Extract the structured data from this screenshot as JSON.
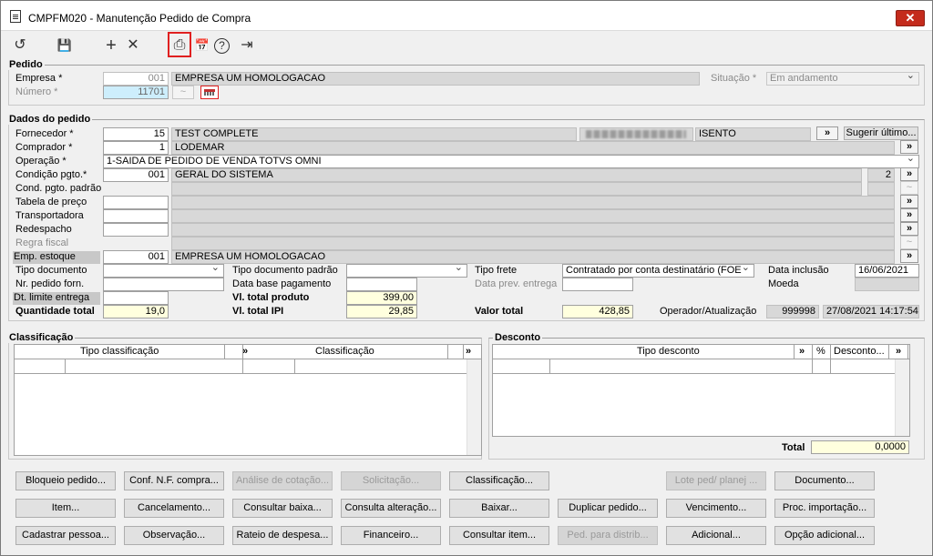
{
  "window": {
    "title": "CMPFM020 - Manutenção Pedido de Compra",
    "close": "✕"
  },
  "toolbar": {
    "undo": "↺",
    "save": "💾",
    "add": "+",
    "delete": "✕",
    "print": "⎙",
    "calendar": "📅",
    "help": "?",
    "exit": "⇥"
  },
  "pedido": {
    "title": "Pedido",
    "empresa_label": "Empresa *",
    "empresa_code": "001",
    "empresa_name": "EMPRESA UM HOMOLOGACAO",
    "situacao_label": "Situação *",
    "situacao_value": "Em andamento",
    "numero_label": "Número *",
    "numero_value": "11701"
  },
  "dados": {
    "title": "Dados do pedido",
    "fornecedor_label": "Fornecedor *",
    "fornecedor_code": "15",
    "fornecedor_name": "TEST COMPLETE",
    "fornecedor_tax": "ISENTO",
    "sugerir": "Sugerir último...",
    "comprador_label": "Comprador *",
    "comprador_code": "1",
    "comprador_name": "LODEMAR",
    "operacao_label": "Operação *",
    "operacao_value": "1-SAIDA DE PEDIDO DE VENDA TOTVS OMNI",
    "condicao_label": "Condição pgto.*",
    "condicao_code": "001",
    "condicao_name": "GERAL DO SISTEMA",
    "condicao_num": "2",
    "cond_padrao_label": "Cond. pgto. padrão",
    "tabela_label": "Tabela de preço",
    "transportadora_label": "Transportadora",
    "redespacho_label": "Redespacho",
    "regra_label": "Regra fiscal",
    "emp_estoque_label": "Emp. estoque",
    "emp_estoque_code": "001",
    "emp_estoque_name": "EMPRESA UM HOMOLOGACAO",
    "tipo_doc_label": "Tipo documento",
    "tipo_doc_padrao_label": "Tipo documento padrão",
    "tipo_frete_label": "Tipo frete",
    "tipo_frete_value": "Contratado por conta destinatário (FOE",
    "data_inclusao_label": "Data inclusão",
    "data_inclusao_value": "16/06/2021",
    "nr_pedido_label": "Nr. pedido forn.",
    "data_base_label": "Data base pagamento",
    "data_prev_label": "Data prev. entrega",
    "moeda_label": "Moeda",
    "dt_limite_label": "Dt. limite entrega",
    "vl_produto_label": "Vl. total produto",
    "vl_produto_value": "399,00",
    "quantidade_label": "Quantidade total",
    "quantidade_value": "19,0",
    "vl_ipi_label": "Vl. total IPI",
    "vl_ipi_value": "29,85",
    "valor_total_label": "Valor total",
    "valor_total_value": "428,85",
    "operador_label": "Operador/Atualização",
    "operador_value": "999998",
    "atualizacao_value": "27/08/2021 14:17:54"
  },
  "classificacao": {
    "title": "Classificação",
    "col_tipo": "Tipo classificação",
    "col_class": "Classificação",
    "more": "»"
  },
  "desconto": {
    "title": "Desconto",
    "col_tipo": "Tipo desconto",
    "col_pct": "%",
    "col_desc": "Desconto...",
    "more": "»",
    "total_label": "Total",
    "total_value": "0,0000"
  },
  "buttons": {
    "row1": [
      {
        "label": "Bloqueio pedido...",
        "enabled": true
      },
      {
        "label": "Conf. N.F. compra...",
        "enabled": true
      },
      {
        "label": "Análise de cotação...",
        "enabled": false
      },
      {
        "label": "Solicitação...",
        "enabled": false
      },
      {
        "label": "Classificação...",
        "enabled": true
      },
      {
        "label": "Lote ped/ planej ...",
        "enabled": false
      },
      {
        "label": "Documento...",
        "enabled": true
      }
    ],
    "row2": [
      {
        "label": "Item...",
        "enabled": true
      },
      {
        "label": "Cancelamento...",
        "enabled": true
      },
      {
        "label": "Consultar baixa...",
        "enabled": true
      },
      {
        "label": "Consulta alteração...",
        "enabled": true
      },
      {
        "label": "Baixar...",
        "enabled": true
      },
      {
        "label": "Duplicar pedido...",
        "enabled": true
      },
      {
        "label": "Vencimento...",
        "enabled": true
      },
      {
        "label": "Proc. importação...",
        "enabled": true
      }
    ],
    "row3": [
      {
        "label": "Cadastrar pessoa...",
        "enabled": true
      },
      {
        "label": "Observação...",
        "enabled": true
      },
      {
        "label": "Rateio de despesa...",
        "enabled": true
      },
      {
        "label": "Financeiro...",
        "enabled": true
      },
      {
        "label": "Consultar item...",
        "enabled": true
      },
      {
        "label": "Ped. para distrib...",
        "enabled": false
      },
      {
        "label": "Adicional...",
        "enabled": true
      },
      {
        "label": "Opção adicional...",
        "enabled": true
      }
    ]
  }
}
